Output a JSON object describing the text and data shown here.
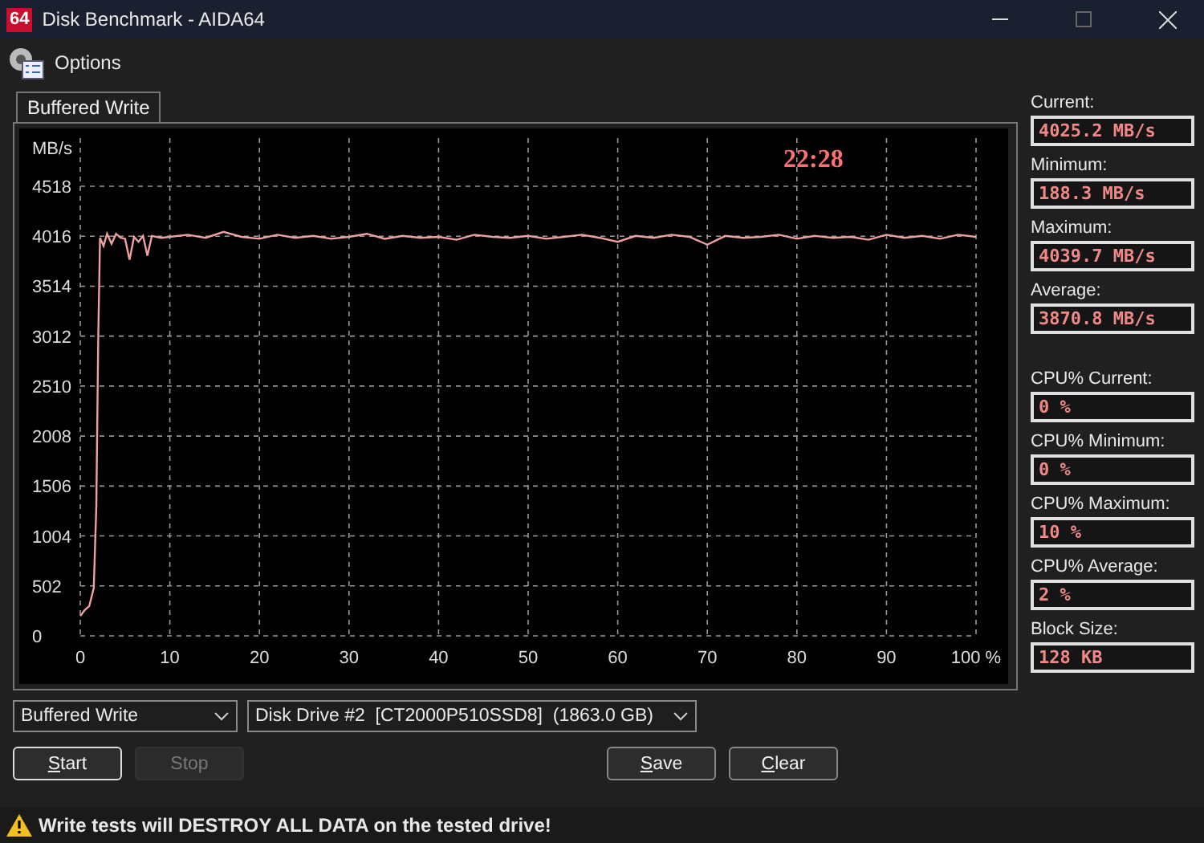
{
  "window": {
    "title": "Disk Benchmark - AIDA64",
    "app_icon": "64"
  },
  "toolbar": {
    "items": [
      {
        "label": "Options"
      }
    ]
  },
  "tabs": [
    {
      "label": "Buffered Write",
      "selected": true
    }
  ],
  "chart_panel": {
    "elapsed_time": "22:28",
    "chart_data": {
      "type": "line",
      "ylabel": "MB/s",
      "grid": true,
      "xlim": [
        0,
        100
      ],
      "ylim": [
        0,
        4518
      ],
      "yticks": [
        0,
        502,
        1004,
        1506,
        2008,
        2510,
        3012,
        3514,
        4016,
        4518
      ],
      "xticks": [
        0,
        10,
        20,
        30,
        40,
        50,
        60,
        70,
        80,
        90,
        {
          "value": 100,
          "label": "100 %"
        }
      ],
      "x": [
        0,
        0.5,
        1,
        1.5,
        1.8,
        2,
        2.2,
        2.6,
        3,
        3.5,
        4,
        4.5,
        5,
        5.5,
        6,
        6.5,
        7,
        7.5,
        8,
        9,
        10,
        12,
        14,
        16,
        18,
        20,
        22,
        24,
        26,
        28,
        30,
        32,
        34,
        36,
        38,
        40,
        42,
        44,
        46,
        48,
        50,
        52,
        54,
        56,
        58,
        60,
        62,
        64,
        66,
        68,
        70,
        72,
        74,
        76,
        78,
        80,
        82,
        84,
        86,
        88,
        90,
        92,
        94,
        96,
        98,
        100
      ],
      "series": [
        {
          "color": "#f0a0a0",
          "values": [
            200,
            260,
            300,
            480,
            1300,
            3000,
            4000,
            3920,
            4040,
            3940,
            4040,
            4000,
            3990,
            3780,
            4010,
            3960,
            4020,
            3820,
            4020,
            4000,
            4010,
            4030,
            4000,
            4060,
            4010,
            3990,
            4030,
            4000,
            4020,
            3990,
            4010,
            4040,
            3990,
            4020,
            4000,
            4010,
            3980,
            4030,
            4010,
            4000,
            4020,
            3990,
            4010,
            4030,
            4000,
            3960,
            4020,
            4000,
            4030,
            4010,
            3930,
            4020,
            4000,
            4010,
            4030,
            3990,
            4020,
            4000,
            4010,
            3980,
            4030,
            4000,
            4020,
            3990,
            4030,
            4010
          ]
        }
      ]
    }
  },
  "speed_stats": [
    {
      "label": "Current:",
      "value": "4025.2 MB/s"
    },
    {
      "label": "Minimum:",
      "value": "188.3 MB/s"
    },
    {
      "label": "Maximum:",
      "value": "4039.7 MB/s"
    },
    {
      "label": "Average:",
      "value": "3870.8 MB/s"
    }
  ],
  "cpu_stats": [
    {
      "label": "CPU% Current:",
      "value": "0 %"
    },
    {
      "label": "CPU% Minimum:",
      "value": "0 %"
    },
    {
      "label": "CPU% Maximum:",
      "value": "10 %"
    },
    {
      "label": "CPU% Average:",
      "value": "2 %"
    },
    {
      "label": "Block Size:",
      "value": "128 KB"
    }
  ],
  "test_select": {
    "value": "Buffered Write"
  },
  "drive_select": {
    "value": "Disk Drive #2  [CT2000P510SSD8]  (1863.0 GB)"
  },
  "run_buttons": [
    {
      "label": "Start",
      "disabled": false,
      "default": true
    },
    {
      "label": "Stop",
      "disabled": true,
      "default": false
    }
  ],
  "result_buttons": [
    {
      "label": "Save",
      "disabled": false,
      "default": false
    },
    {
      "label": "Clear",
      "disabled": false,
      "default": false
    }
  ],
  "status_bar": {
    "warning": "Write tests will DESTROY ALL DATA on the tested drive!"
  }
}
